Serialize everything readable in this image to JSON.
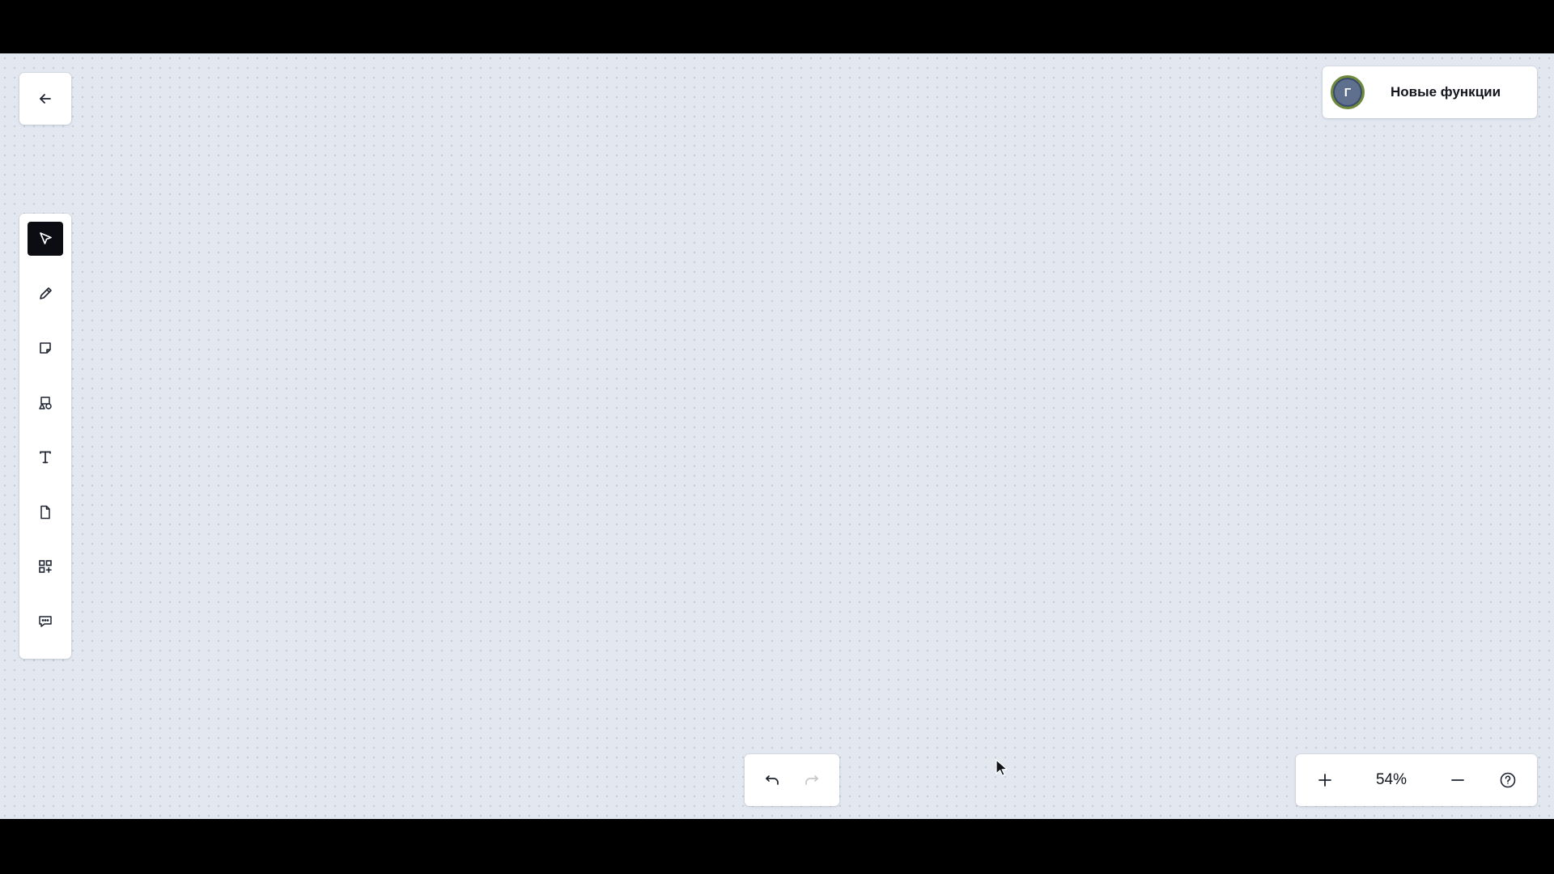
{
  "header": {
    "back_icon": "arrow-left-icon",
    "news_label": "Новые функции",
    "avatar_initial": "Г"
  },
  "toolbar": {
    "tools": [
      {
        "name": "select",
        "icon": "cursor-arrow-icon",
        "active": true
      },
      {
        "name": "pen",
        "icon": "pencil-icon",
        "active": false
      },
      {
        "name": "sticky-note",
        "icon": "sticky-note-icon",
        "active": false
      },
      {
        "name": "shapes",
        "icon": "shapes-icon",
        "active": false
      },
      {
        "name": "text",
        "icon": "text-icon",
        "active": false
      },
      {
        "name": "document",
        "icon": "document-icon",
        "active": false
      },
      {
        "name": "widgets",
        "icon": "widgets-icon",
        "active": false
      },
      {
        "name": "comment",
        "icon": "comment-icon",
        "active": false
      }
    ]
  },
  "history": {
    "undo_icon": "undo-icon",
    "redo_icon": "redo-icon",
    "redo_disabled": true
  },
  "zoom": {
    "value": "54%",
    "zoom_in_icon": "plus-icon",
    "zoom_out_icon": "minus-icon",
    "help_icon": "help-icon"
  },
  "colors": {
    "canvas": "#e2e7f0",
    "active_tool": "#0b0d12",
    "avatar": "#5f6f8e",
    "avatar_ring": "#6e8a3a"
  }
}
